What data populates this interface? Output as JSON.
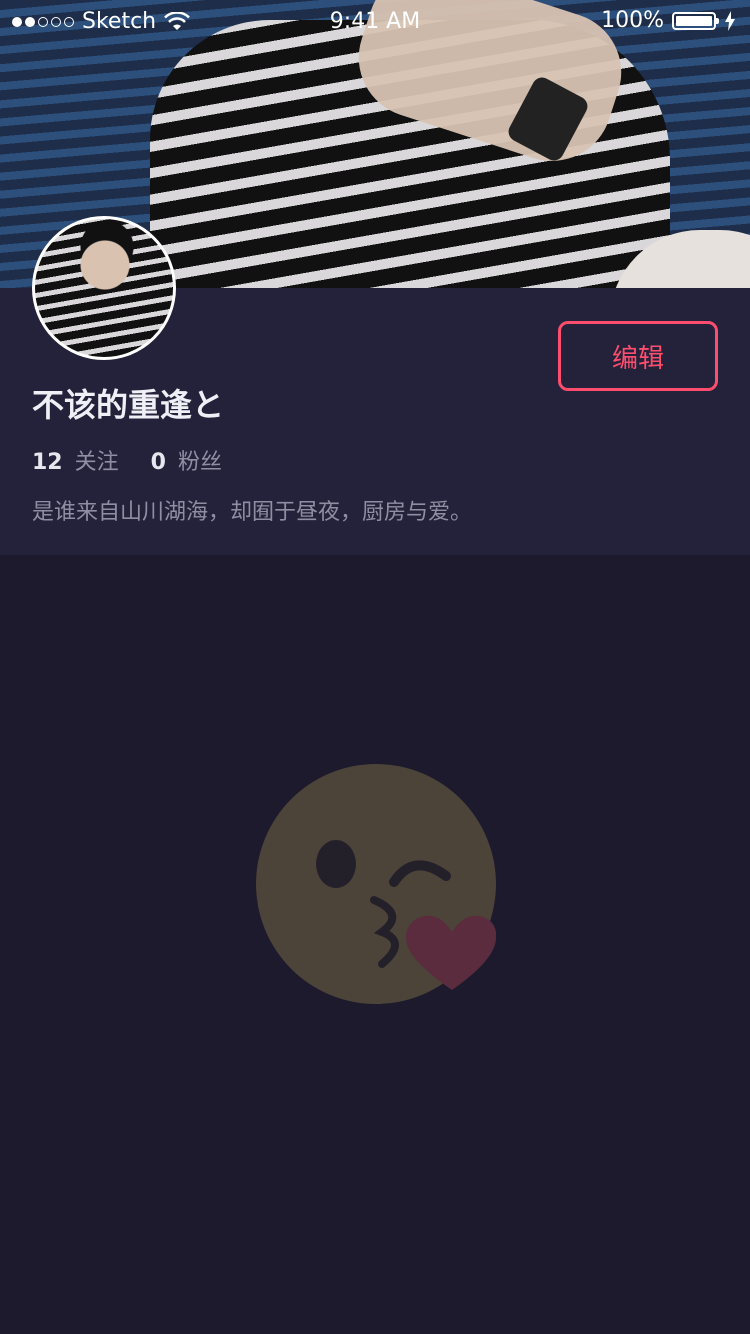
{
  "status_bar": {
    "carrier": "Sketch",
    "time": "9:41 AM",
    "battery": "100%",
    "signal_dots": [
      true,
      true,
      false,
      false,
      false
    ]
  },
  "profile": {
    "name": "不该的重逢と",
    "edit_label": "编辑",
    "following_count": "12",
    "following_label": "关注",
    "followers_count": "0",
    "followers_label": "粉丝",
    "bio": "是谁来自山川湖海，却囿于昼夜，厨房与爱。"
  },
  "colors": {
    "accent": "#ff4d6d",
    "panel": "#23223a",
    "background": "#1c1a2c"
  },
  "empty_state": {
    "icon": "kissing-face-icon"
  }
}
